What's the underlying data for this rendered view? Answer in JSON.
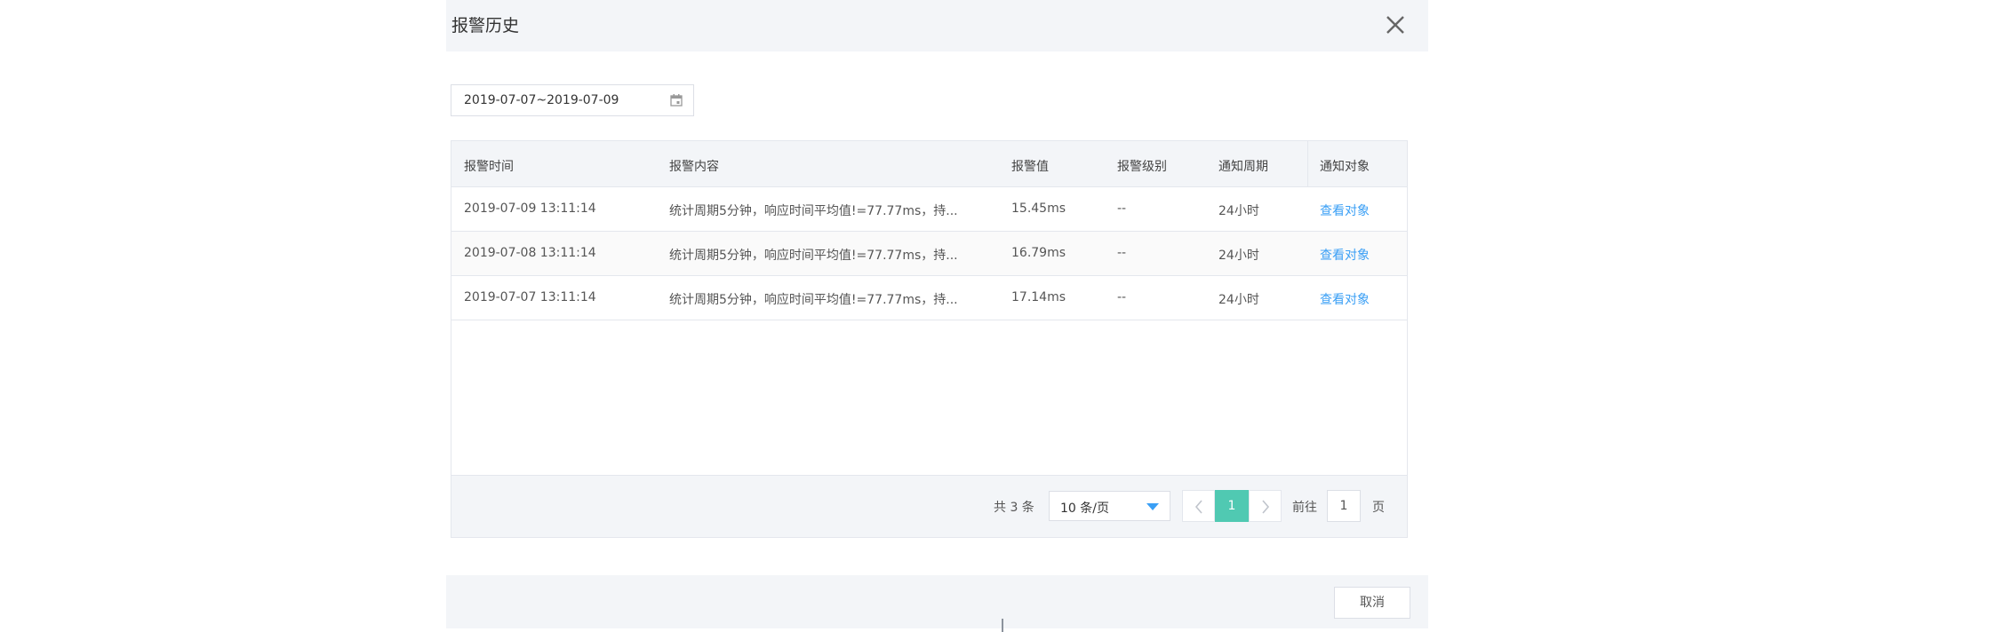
{
  "dialog": {
    "title": "报警历史",
    "close_icon": "close-icon"
  },
  "filter": {
    "date_range": "2019-07-07~2019-07-09",
    "calendar_icon": "calendar-icon"
  },
  "table": {
    "headers": [
      "报警时间",
      "报警内容",
      "报警值",
      "报警级别",
      "通知周期",
      "通知对象"
    ],
    "rows": [
      {
        "time": "2019-07-09 13:11:14",
        "content": "统计周期5分钟，响应时间平均值!=77.77ms，持...",
        "value": "15.45ms",
        "level": "--",
        "period": "24小时",
        "target": "查看对象"
      },
      {
        "time": "2019-07-08 13:11:14",
        "content": "统计周期5分钟，响应时间平均值!=77.77ms，持...",
        "value": "16.79ms",
        "level": "--",
        "period": "24小时",
        "target": "查看对象"
      },
      {
        "time": "2019-07-07 13:11:14",
        "content": "统计周期5分钟，响应时间平均值!=77.77ms，持...",
        "value": "17.14ms",
        "level": "--",
        "period": "24小时",
        "target": "查看对象"
      }
    ]
  },
  "pagination": {
    "total": "共 3 条",
    "page_size": "10 条/页",
    "current_page": "1",
    "goto_label": "前往",
    "goto_value": "1",
    "page_suffix": "页"
  },
  "footer": {
    "cancel_label": "取消"
  },
  "colors": {
    "accent": "#3a9ff5",
    "active_page": "#50c9b2",
    "header_bg": "#f3f5f8"
  }
}
